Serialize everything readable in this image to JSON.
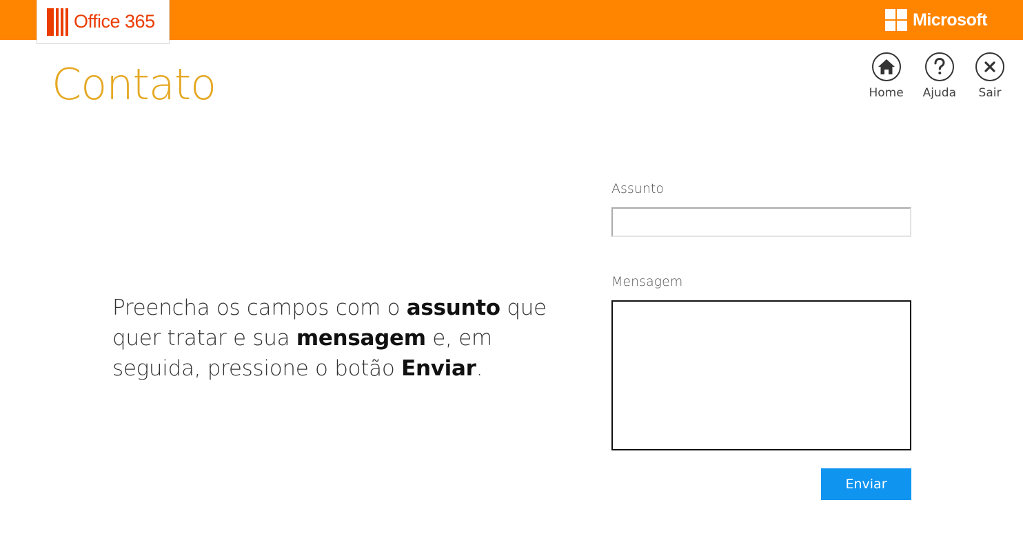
{
  "header": {
    "product_name": "Office 365",
    "brand_name": "Microsoft",
    "bar_color": "#ff8400",
    "logo_color": "#eb3c00"
  },
  "page": {
    "title": "Contato",
    "title_color": "#e5a823"
  },
  "nav": {
    "items": [
      {
        "label": "Home",
        "icon": "home-icon"
      },
      {
        "label": "Ajuda",
        "icon": "help-icon"
      },
      {
        "label": "Sair",
        "icon": "close-icon"
      }
    ]
  },
  "instructions": {
    "part1": "Preencha os campos com o ",
    "bold1": "assunto",
    "part2": " que quer tratar e sua ",
    "bold2": "mensagem",
    "part3": " e, em seguida, pressione o botão ",
    "bold3": "Enviar",
    "part4": "."
  },
  "form": {
    "subject_label": "Assunto",
    "subject_value": "",
    "message_label": "Mensagem",
    "message_value": "",
    "submit_label": "Enviar",
    "submit_color": "#0f94f0"
  }
}
